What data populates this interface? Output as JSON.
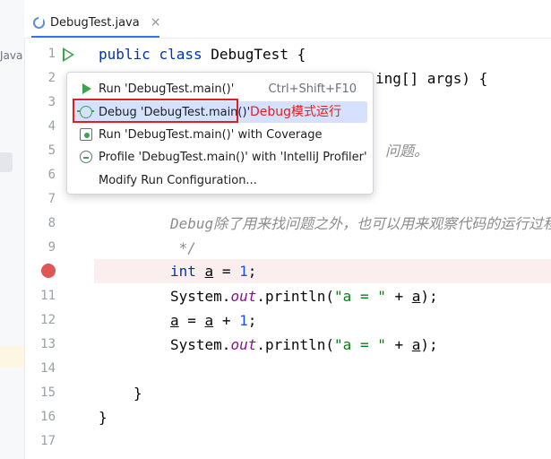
{
  "tab": {
    "title": "DebugTest.java",
    "close": "×"
  },
  "left_strip": {
    "label": "Java"
  },
  "gutter": {
    "line_numbers": [
      "1",
      "2",
      "3",
      "4",
      "5",
      "6",
      "7",
      "8",
      "9",
      "10",
      "11",
      "12",
      "13",
      "14",
      "15",
      "16",
      "17"
    ]
  },
  "code": {
    "l1_kw1": "public",
    "l1_kw2": "class",
    "l1_name": "DebugTest {",
    "l2_rest": "ing[] args) {",
    "l5_cmt": "问题。",
    "l8_cmt": "Debug除了用来找问题之外，也可以用来观察代码的运行过程",
    "l9_cmt": " */",
    "l10_kw": "int",
    "l10_var": "a",
    "l10_op": " = ",
    "l10_num": "1",
    "l10_end": ";",
    "l11_pre": "System.",
    "l11_fld": "out",
    "l11_mid": ".println(",
    "l11_str": "\"a = \"",
    "l11_op": " + ",
    "l11_var": "a",
    "l11_end": ");",
    "l12_var1": "a",
    "l12_op1": " = ",
    "l12_var2": "a",
    "l12_op2": " + ",
    "l12_num": "1",
    "l12_end": ";",
    "l13_pre": "System.",
    "l13_fld": "out",
    "l13_mid": ".println(",
    "l13_str": "\"a = \"",
    "l13_op": " + ",
    "l13_var": "a",
    "l13_end": ");",
    "l15": "}",
    "l16": "}"
  },
  "popup": {
    "items": [
      {
        "label": "Run 'DebugTest.main()'",
        "shortcut": "Ctrl+Shift+F10",
        "icon": "run-icon"
      },
      {
        "label": "Debug 'DebugTest.main()'",
        "icon": "debug-icon"
      },
      {
        "label": "Run 'DebugTest.main()' with Coverage",
        "icon": "coverage-icon"
      },
      {
        "label": "Profile 'DebugTest.main()' with 'IntelliJ Profiler'",
        "icon": "profiler-icon"
      },
      {
        "label": "Modify Run Configuration...",
        "icon": ""
      }
    ]
  },
  "annotation": {
    "text": "Debug模式运行"
  },
  "colors": {
    "keyword": "#0033b3",
    "string": "#067d17",
    "number": "#1750eb",
    "breakpoint": "#e05555",
    "annotation": "#e02020",
    "selection": "#d5e1ff"
  }
}
